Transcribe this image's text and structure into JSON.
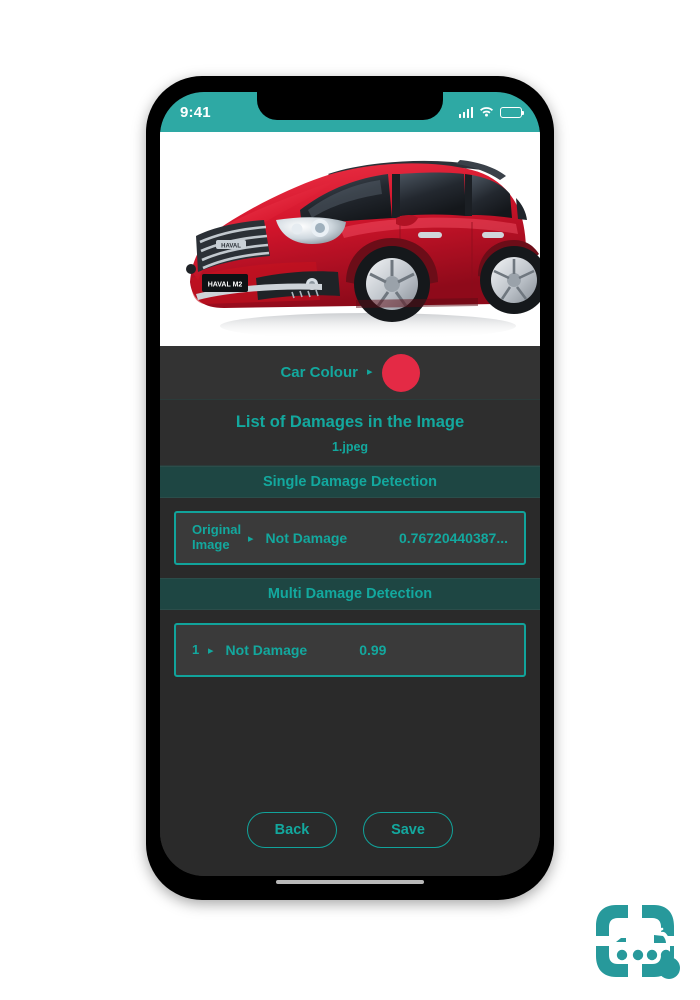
{
  "status_bar": {
    "time": "9:41",
    "signal_icon": "signal-bars-icon",
    "wifi_icon": "wifi-icon",
    "battery_icon": "battery-full-icon"
  },
  "photo": {
    "alt": "Red Haval M2 SUV front three-quarter view",
    "badge_text": "HAVAL M2",
    "grille_text": "HAVAL"
  },
  "car_colour": {
    "label": "Car Colour",
    "arrow": "▸",
    "swatch_hex": "#e42a45"
  },
  "list": {
    "title": "List of Damages in the Image",
    "file_name": "1.jpeg"
  },
  "single_detection": {
    "header": "Single Damage Detection",
    "rows": [
      {
        "index": "Original Image",
        "arrow": "▸",
        "label": "Not Damage",
        "score": "0.76720440387..."
      }
    ]
  },
  "multi_detection": {
    "header": "Multi Damage Detection",
    "rows": [
      {
        "index": "1",
        "arrow": "▸",
        "label": "Not Damage",
        "score": "0.99"
      }
    ]
  },
  "footer": {
    "back_label": "Back",
    "save_label": "Save"
  },
  "theme": {
    "accent_teal": "#13a89e",
    "status_bar_teal": "#2ea9a4",
    "section_band": "#1e4643",
    "card_bg": "#3a3a3a",
    "screen_bg": "#2a2a2a",
    "row_bg": "#333333"
  },
  "brand": {
    "logo_name": "car-crash-scan-logo"
  }
}
